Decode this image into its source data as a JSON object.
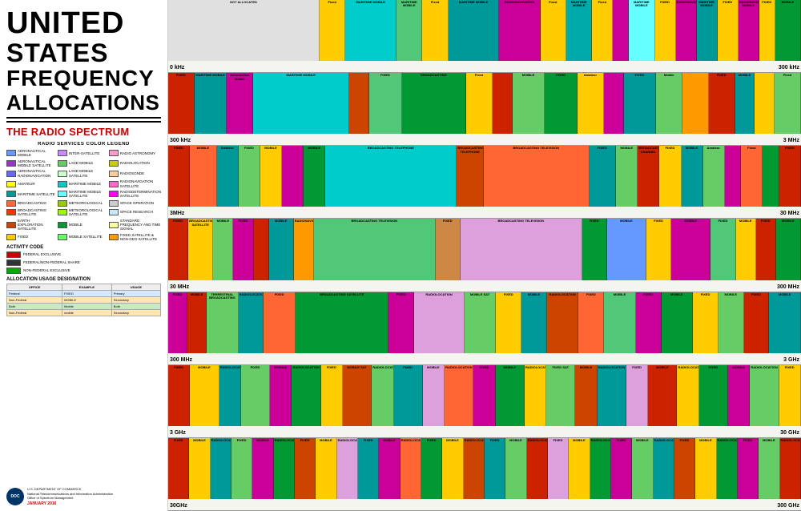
{
  "title": {
    "line1": "UNITED",
    "line2": "STATES",
    "line3": "FREQUENCY",
    "line4": "ALLOCATIONS",
    "subtitle": "THE RADIO SPECTRUM"
  },
  "legend": {
    "title": "RADIO SERVICES COLOR LEGEND",
    "items": [
      {
        "label": "AERONAUTICAL MOBILE",
        "color": "#6699ff"
      },
      {
        "label": "INTER-SATELLITE",
        "color": "#cc88ff"
      },
      {
        "label": "RADIO ASTRONOMY",
        "color": "#ff99cc"
      },
      {
        "label": "AERONAUTICAL MOBILE SATELLITE",
        "color": "#9933cc"
      },
      {
        "label": "LAND MOBILE",
        "color": "#66cc66"
      },
      {
        "label": "RADIOLOCATION",
        "color": "#ffff00"
      },
      {
        "label": "AERONAUTICAL RADIONAVIGATION",
        "color": "#6666ff"
      },
      {
        "label": "LAND MOBILE SATELLITE",
        "color": "#ccffcc"
      },
      {
        "label": "RADIOSONDE",
        "color": "#ffcc99"
      },
      {
        "label": "AMATEUR",
        "color": "#ffff00"
      },
      {
        "label": "MARITIME MOBILE",
        "color": "#00cccc"
      },
      {
        "label": "RADIONAVIGATION SATELLITE",
        "color": "#ff66cc"
      },
      {
        "label": "MARITIME SATELLITE",
        "color": "#009999"
      },
      {
        "label": "MARITIME MOBILE SATELLITE",
        "color": "#66ffff"
      },
      {
        "label": "RADIODETERMINATION SATELLITE",
        "color": "#ff00ff"
      },
      {
        "label": "BROADCASTING",
        "color": "#ff6633"
      },
      {
        "label": "METEOROLOGICAL",
        "color": "#99cc00"
      },
      {
        "label": "SPACE OPERATION",
        "color": "#cccccc"
      },
      {
        "label": "BROADCASTING SATELLITE",
        "color": "#ff3300"
      },
      {
        "label": "METEOROLOGICAL SATELLITE",
        "color": "#99ff00"
      },
      {
        "label": "SPACE RESEARCH",
        "color": "#c8e8f8"
      },
      {
        "label": "EARTH EXPLORATION SATELLITE",
        "color": "#cc4400"
      },
      {
        "label": "MOBILE",
        "color": "#009933"
      },
      {
        "label": "STANDARD FREQUENCY AND TIME SIGNAL",
        "color": "#ffff99"
      },
      {
        "label": "FIXED",
        "color": "#ffcc00"
      },
      {
        "label": "MOBILE SATELLITE",
        "color": "#66ff66"
      },
      {
        "label": "FIXED SATELLITE AND NON-GEO SATELLITE",
        "color": "#ff9900"
      }
    ]
  },
  "activity": {
    "title": "ACTIVITY CODE",
    "items": [
      {
        "label": "FEDERAL EXCLUSIVE",
        "color": "#cc0000"
      },
      {
        "label": "FEDERAL/NON-FEDERAL SHARE",
        "color": "#333333"
      },
      {
        "label": "NON-FEDERAL EXCLUSIVE",
        "color": "#00aa00"
      }
    ]
  },
  "allocation": {
    "title": "ALLOCATION USAGE DESIGNATION",
    "headers": [
      "OFFICE",
      "EXAMPLE",
      "USAGE"
    ],
    "rows": [
      {
        "type": "govt",
        "cols": [
          "Federal",
          "FIXED",
          "Primary"
        ]
      },
      {
        "type": "nongov",
        "cols": [
          "Non-Federal",
          "MOBILE",
          "Secondary"
        ]
      },
      {
        "type": "both",
        "cols": [
          "Both",
          "Mobile",
          "Both"
        ]
      },
      {
        "type": "nongov",
        "cols": [
          "Non-Federal",
          "mobile",
          "Secondary"
        ]
      }
    ]
  },
  "rows": [
    {
      "label_left": "0 kHz",
      "label_right": "300 kHz"
    },
    {
      "label_left": "300 kHz",
      "label_right": "3 MHz"
    },
    {
      "label_left": "3MHz",
      "label_right": "30 MHz"
    },
    {
      "label_left": "30 MHz",
      "label_right": "300 MHz"
    },
    {
      "label_left": "300 MHz",
      "label_right": "3 GHz"
    },
    {
      "label_left": "3 GHz",
      "label_right": "30 GHz"
    },
    {
      "label_left": "30GHz",
      "label_right": "300 GHz"
    }
  ],
  "footer": {
    "agency": "U.S. DEPARTMENT OF COMMERCE",
    "sub1": "National Telecommunications and Information Administration",
    "sub2": "Office of Spectrum Management",
    "date": "JANUARY 2016"
  }
}
